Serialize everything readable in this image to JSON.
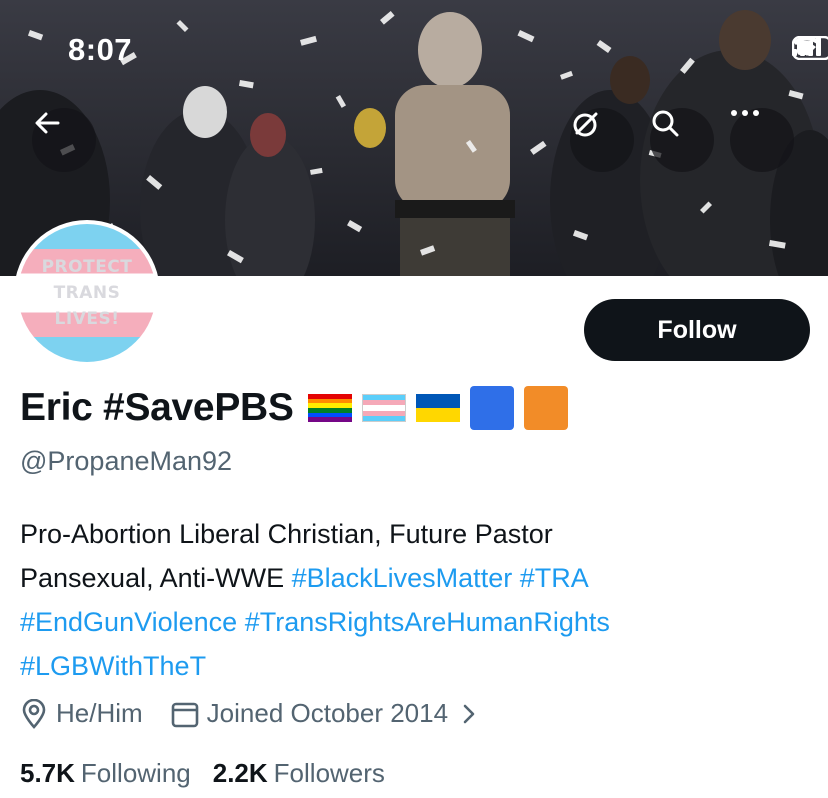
{
  "status_bar": {
    "time": "8:07"
  },
  "banner": {
    "description_icons": [
      "back-arrow-icon",
      "grok-icon",
      "search-icon",
      "more-icon"
    ]
  },
  "avatar": {
    "text_lines": [
      "PROTECT",
      "TRANS",
      "LIVES!"
    ]
  },
  "profile": {
    "display_name": "Eric #SavePBS",
    "flags": [
      "rainbow-flag",
      "transgender-flag",
      "ukraine-flag",
      "blue-square",
      "orange-square"
    ],
    "handle": "@PropaneMan92",
    "follow_label": "Follow",
    "bio": {
      "line1": "Pro-Abortion Liberal Christian, Future Pastor",
      "line2_text": "Pansexual, Anti-WWE ",
      "hashtags": [
        "#BlackLivesMatter",
        "#TRA",
        "#EndGunViolence",
        "#TransRightsAreHumanRights",
        "#LGBWithTheT"
      ]
    },
    "pronouns": "He/Him",
    "joined": "Joined October 2014",
    "following_count": "5.7K",
    "following_label": "Following",
    "followers_count": "2.2K",
    "followers_label": "Followers"
  },
  "colors": {
    "accent": "#1d9bf0",
    "text": "#0f1419",
    "muted": "#536471",
    "button": "#0f1419"
  }
}
